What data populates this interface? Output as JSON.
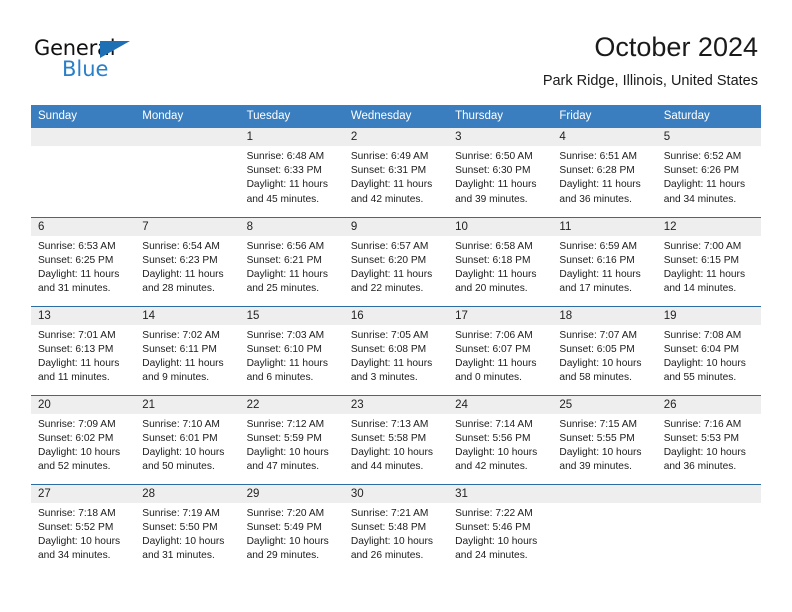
{
  "brand": {
    "name_dark": "General",
    "name_blue": "Blue",
    "accent_color": "#2a7fc9",
    "triangle_color": "#1f6fb5"
  },
  "header": {
    "title": "October 2024",
    "subtitle": "Park Ridge, Illinois, United States"
  },
  "theme": {
    "header_row_bg": "#3a7ebf",
    "header_row_text": "#ffffff",
    "week_divider": "#2e6da4",
    "daynum_bg": "#eeeeee"
  },
  "weekdays": [
    "Sunday",
    "Monday",
    "Tuesday",
    "Wednesday",
    "Thursday",
    "Friday",
    "Saturday"
  ],
  "weeks": [
    [
      {
        "day": "",
        "blank": true
      },
      {
        "day": "",
        "blank": true
      },
      {
        "day": "1",
        "sunrise": "Sunrise: 6:48 AM",
        "sunset": "Sunset: 6:33 PM",
        "daylight": "Daylight: 11 hours and 45 minutes."
      },
      {
        "day": "2",
        "sunrise": "Sunrise: 6:49 AM",
        "sunset": "Sunset: 6:31 PM",
        "daylight": "Daylight: 11 hours and 42 minutes."
      },
      {
        "day": "3",
        "sunrise": "Sunrise: 6:50 AM",
        "sunset": "Sunset: 6:30 PM",
        "daylight": "Daylight: 11 hours and 39 minutes."
      },
      {
        "day": "4",
        "sunrise": "Sunrise: 6:51 AM",
        "sunset": "Sunset: 6:28 PM",
        "daylight": "Daylight: 11 hours and 36 minutes."
      },
      {
        "day": "5",
        "sunrise": "Sunrise: 6:52 AM",
        "sunset": "Sunset: 6:26 PM",
        "daylight": "Daylight: 11 hours and 34 minutes."
      }
    ],
    [
      {
        "day": "6",
        "sunrise": "Sunrise: 6:53 AM",
        "sunset": "Sunset: 6:25 PM",
        "daylight": "Daylight: 11 hours and 31 minutes."
      },
      {
        "day": "7",
        "sunrise": "Sunrise: 6:54 AM",
        "sunset": "Sunset: 6:23 PM",
        "daylight": "Daylight: 11 hours and 28 minutes."
      },
      {
        "day": "8",
        "sunrise": "Sunrise: 6:56 AM",
        "sunset": "Sunset: 6:21 PM",
        "daylight": "Daylight: 11 hours and 25 minutes."
      },
      {
        "day": "9",
        "sunrise": "Sunrise: 6:57 AM",
        "sunset": "Sunset: 6:20 PM",
        "daylight": "Daylight: 11 hours and 22 minutes."
      },
      {
        "day": "10",
        "sunrise": "Sunrise: 6:58 AM",
        "sunset": "Sunset: 6:18 PM",
        "daylight": "Daylight: 11 hours and 20 minutes."
      },
      {
        "day": "11",
        "sunrise": "Sunrise: 6:59 AM",
        "sunset": "Sunset: 6:16 PM",
        "daylight": "Daylight: 11 hours and 17 minutes."
      },
      {
        "day": "12",
        "sunrise": "Sunrise: 7:00 AM",
        "sunset": "Sunset: 6:15 PM",
        "daylight": "Daylight: 11 hours and 14 minutes."
      }
    ],
    [
      {
        "day": "13",
        "sunrise": "Sunrise: 7:01 AM",
        "sunset": "Sunset: 6:13 PM",
        "daylight": "Daylight: 11 hours and 11 minutes."
      },
      {
        "day": "14",
        "sunrise": "Sunrise: 7:02 AM",
        "sunset": "Sunset: 6:11 PM",
        "daylight": "Daylight: 11 hours and 9 minutes."
      },
      {
        "day": "15",
        "sunrise": "Sunrise: 7:03 AM",
        "sunset": "Sunset: 6:10 PM",
        "daylight": "Daylight: 11 hours and 6 minutes."
      },
      {
        "day": "16",
        "sunrise": "Sunrise: 7:05 AM",
        "sunset": "Sunset: 6:08 PM",
        "daylight": "Daylight: 11 hours and 3 minutes."
      },
      {
        "day": "17",
        "sunrise": "Sunrise: 7:06 AM",
        "sunset": "Sunset: 6:07 PM",
        "daylight": "Daylight: 11 hours and 0 minutes."
      },
      {
        "day": "18",
        "sunrise": "Sunrise: 7:07 AM",
        "sunset": "Sunset: 6:05 PM",
        "daylight": "Daylight: 10 hours and 58 minutes."
      },
      {
        "day": "19",
        "sunrise": "Sunrise: 7:08 AM",
        "sunset": "Sunset: 6:04 PM",
        "daylight": "Daylight: 10 hours and 55 minutes."
      }
    ],
    [
      {
        "day": "20",
        "sunrise": "Sunrise: 7:09 AM",
        "sunset": "Sunset: 6:02 PM",
        "daylight": "Daylight: 10 hours and 52 minutes."
      },
      {
        "day": "21",
        "sunrise": "Sunrise: 7:10 AM",
        "sunset": "Sunset: 6:01 PM",
        "daylight": "Daylight: 10 hours and 50 minutes."
      },
      {
        "day": "22",
        "sunrise": "Sunrise: 7:12 AM",
        "sunset": "Sunset: 5:59 PM",
        "daylight": "Daylight: 10 hours and 47 minutes."
      },
      {
        "day": "23",
        "sunrise": "Sunrise: 7:13 AM",
        "sunset": "Sunset: 5:58 PM",
        "daylight": "Daylight: 10 hours and 44 minutes."
      },
      {
        "day": "24",
        "sunrise": "Sunrise: 7:14 AM",
        "sunset": "Sunset: 5:56 PM",
        "daylight": "Daylight: 10 hours and 42 minutes."
      },
      {
        "day": "25",
        "sunrise": "Sunrise: 7:15 AM",
        "sunset": "Sunset: 5:55 PM",
        "daylight": "Daylight: 10 hours and 39 minutes."
      },
      {
        "day": "26",
        "sunrise": "Sunrise: 7:16 AM",
        "sunset": "Sunset: 5:53 PM",
        "daylight": "Daylight: 10 hours and 36 minutes."
      }
    ],
    [
      {
        "day": "27",
        "sunrise": "Sunrise: 7:18 AM",
        "sunset": "Sunset: 5:52 PM",
        "daylight": "Daylight: 10 hours and 34 minutes."
      },
      {
        "day": "28",
        "sunrise": "Sunrise: 7:19 AM",
        "sunset": "Sunset: 5:50 PM",
        "daylight": "Daylight: 10 hours and 31 minutes."
      },
      {
        "day": "29",
        "sunrise": "Sunrise: 7:20 AM",
        "sunset": "Sunset: 5:49 PM",
        "daylight": "Daylight: 10 hours and 29 minutes."
      },
      {
        "day": "30",
        "sunrise": "Sunrise: 7:21 AM",
        "sunset": "Sunset: 5:48 PM",
        "daylight": "Daylight: 10 hours and 26 minutes."
      },
      {
        "day": "31",
        "sunrise": "Sunrise: 7:22 AM",
        "sunset": "Sunset: 5:46 PM",
        "daylight": "Daylight: 10 hours and 24 minutes."
      },
      {
        "day": "",
        "blank": true
      },
      {
        "day": "",
        "blank": true
      }
    ]
  ]
}
